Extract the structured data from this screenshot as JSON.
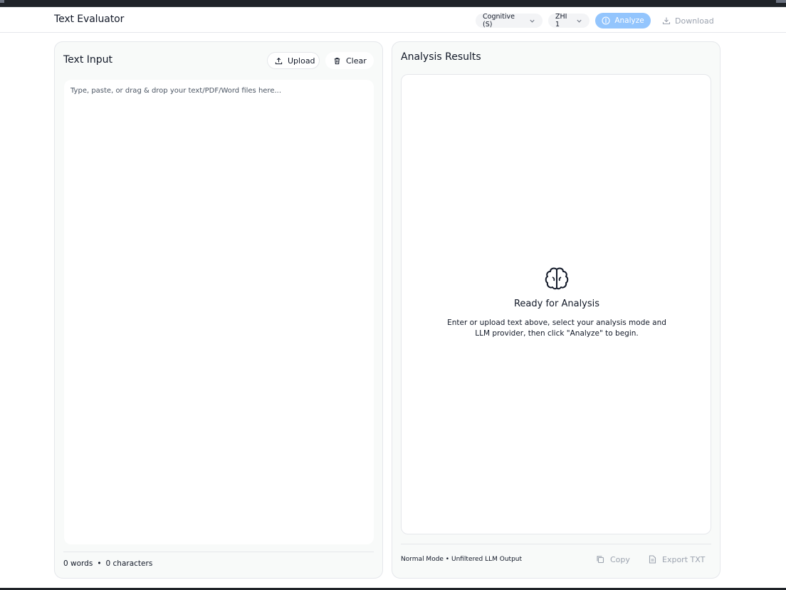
{
  "app": {
    "title": "Text Evaluator"
  },
  "header": {
    "mode_select": {
      "value": "Cognitive (S)"
    },
    "llm_select": {
      "value": "ZHI 1"
    },
    "analyze_label": "Analyze",
    "download_label": "Download"
  },
  "input_panel": {
    "title": "Text Input",
    "upload_label": "Upload",
    "clear_label": "Clear",
    "placeholder": "Type, paste, or drag & drop your text/PDF/Word files here...",
    "words": "0 words",
    "separator": "•",
    "characters": "0 characters"
  },
  "results_panel": {
    "title": "Analysis Results",
    "empty_title": "Ready for Analysis",
    "empty_desc": "Enter or upload text above, select your analysis mode and LLM provider, then click \"Analyze\" to begin.",
    "mode_info": "Normal Mode • Unfiltered LLM Output",
    "copy_label": "Copy",
    "export_label": "Export TXT"
  },
  "icons": {
    "chevron": "chevron-down-icon",
    "analyze": "brain-icon",
    "download": "download-icon",
    "upload": "upload-icon",
    "clear": "trash-icon",
    "empty_state": "brain-icon",
    "copy": "copy-icon",
    "export": "file-text-icon"
  },
  "colors": {
    "accent": "#93c5fd",
    "muted": "#9ca3af",
    "panel_bg": "#f8faf9"
  }
}
